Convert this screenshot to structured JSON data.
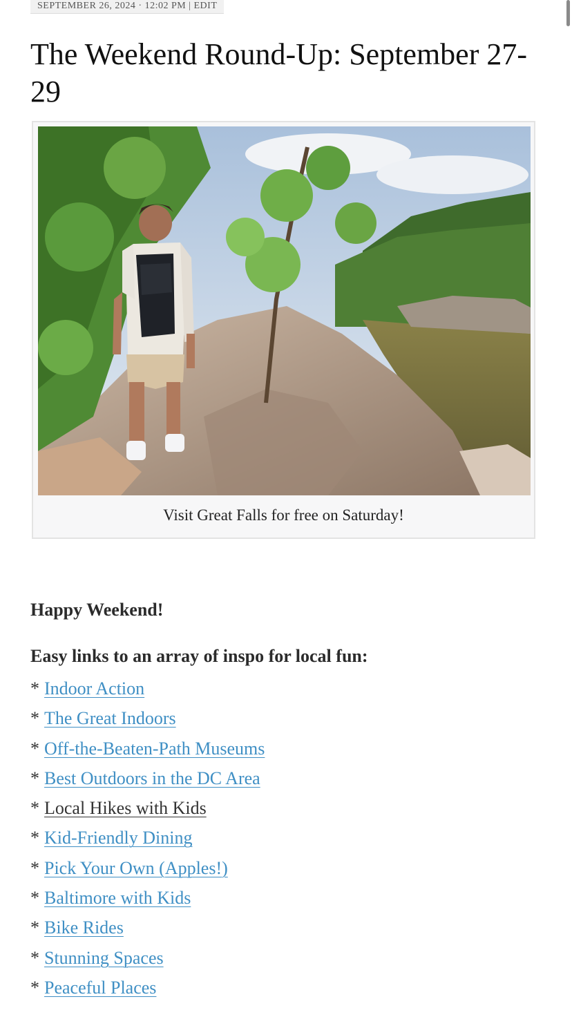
{
  "post": {
    "meta": "SEPTEMBER 26, 2024 · 12:02 PM | EDIT",
    "title": "The Weekend Round-Up: September 27-29",
    "image_caption": "Visit Great Falls for free on Saturday!",
    "greeting": "Happy Weekend!",
    "intro": "Easy links to an array of inspo for local fun:"
  },
  "links": [
    {
      "bullet": "*",
      "label": "Indoor Action"
    },
    {
      "bullet": "*",
      "label": "The Great Indoors"
    },
    {
      "bullet": "*",
      "label": "Off-the-Beaten-Path Museums"
    },
    {
      "bullet": "*",
      "label": "Best Outdoors in the DC Area"
    },
    {
      "bullet": "*",
      "label": "Local Hikes with Kids"
    },
    {
      "bullet": "*",
      "label": "Kid-Friendly Dining"
    },
    {
      "bullet": "*",
      "label": "Pick Your Own (Apples!)"
    },
    {
      "bullet": "*",
      "label": "Baltimore with Kids"
    },
    {
      "bullet": "*",
      "label": "Bike Rides"
    },
    {
      "bullet": "*",
      "label": "Stunning Spaces"
    },
    {
      "bullet": "*",
      "label": "Peaceful Places"
    }
  ],
  "colors": {
    "link": "#3f8fc4",
    "text": "#2b2b2b"
  }
}
